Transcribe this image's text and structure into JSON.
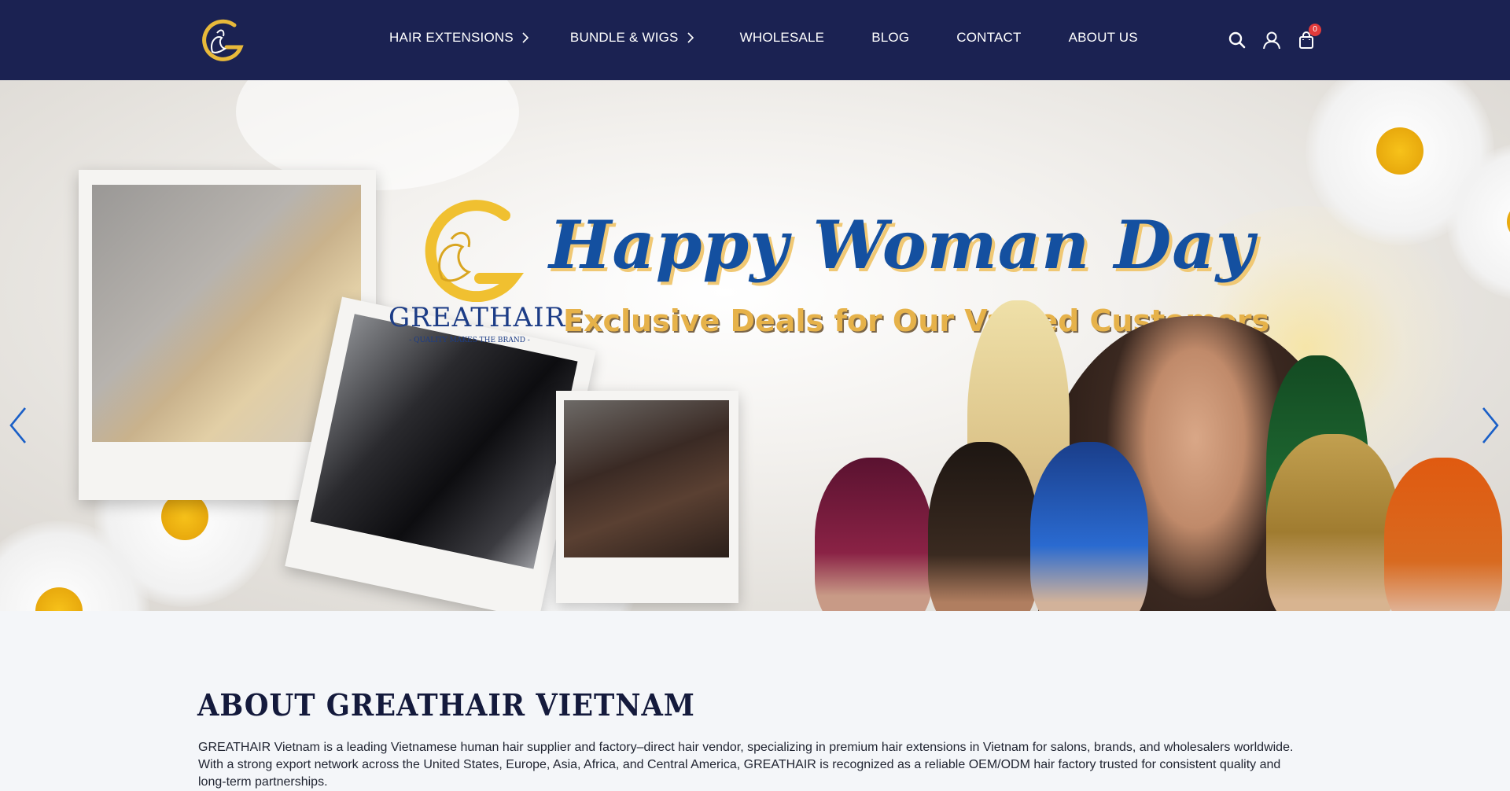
{
  "header": {
    "nav": [
      {
        "label": "HAIR EXTENSIONS",
        "has_submenu": true
      },
      {
        "label": "BUNDLE & WIGS",
        "has_submenu": true
      },
      {
        "label": "WHOLESALE",
        "has_submenu": false
      },
      {
        "label": "BLOG",
        "has_submenu": false
      },
      {
        "label": "CONTACT",
        "has_submenu": false
      },
      {
        "label": "ABOUT US",
        "has_submenu": false
      }
    ],
    "icons": [
      "search-icon",
      "user-icon",
      "cart-icon"
    ],
    "cart_count": "0"
  },
  "hero": {
    "brand_name": "GREATHAIR",
    "brand_tagline": "- QUALITY MAKES THE BRAND -",
    "headline": "Happy Woman Day",
    "subheadline": "Exclusive Deals for Our Valued Customers",
    "prev_icon": "chevron-left-icon",
    "next_icon": "chevron-right-icon"
  },
  "about": {
    "title": "ABOUT GREATHAIR VIETNAM",
    "text": "GREATHAIR Vietnam is a leading Vietnamese human hair supplier and factory–direct hair vendor, specializing in premium hair extensions in Vietnam for salons, brands, and wholesalers worldwide. With a strong export network across the United States, Europe, Asia, Africa, and Central America, GREATHAIR is recognized as a reliable OEM/ODM hair factory trusted for consistent quality and long-term partnerships."
  },
  "colors": {
    "header_bg": "#1b2252",
    "accent_blue": "#1450a0",
    "gold": "#e6b24a",
    "badge_red": "#e23b3b",
    "page_bg": "#f4f6f9"
  }
}
